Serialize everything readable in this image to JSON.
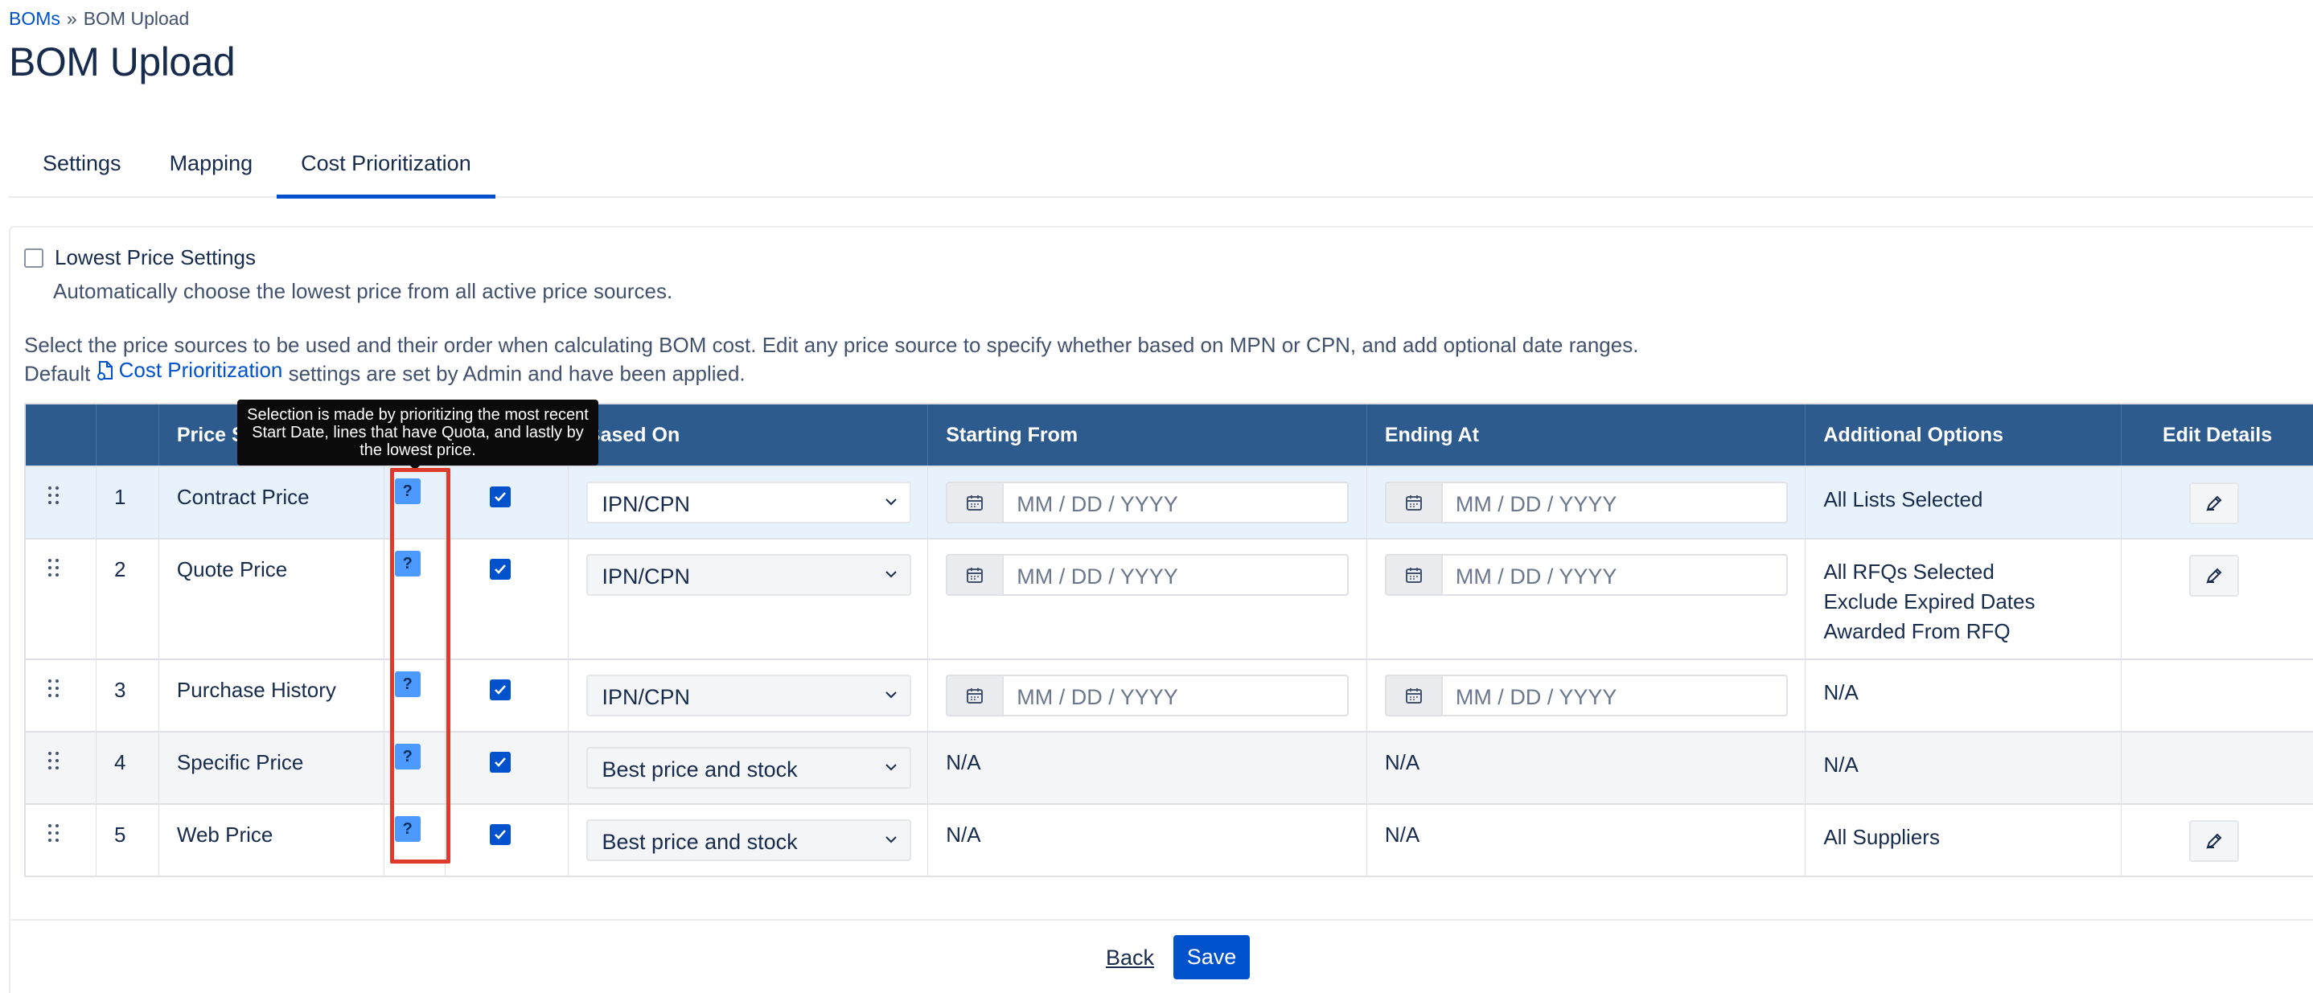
{
  "breadcrumb": {
    "parent": "BOMs",
    "separator": "»",
    "current": "BOM Upload"
  },
  "page_title": "BOM Upload",
  "tabs": [
    {
      "label": "Settings",
      "active": false
    },
    {
      "label": "Mapping",
      "active": false
    },
    {
      "label": "Cost Prioritization",
      "active": true
    }
  ],
  "lowest_price": {
    "label": "Lowest Price Settings",
    "checked": false,
    "description": "Automatically choose the lowest price from all active price sources."
  },
  "instructions": {
    "line1": "Select the price sources to be used and their order when calculating BOM cost. Edit any price source to specify whether based on MPN or CPN, and add optional date ranges.",
    "prefix": "Default",
    "link": "Cost Prioritization",
    "suffix": "settings are set by Admin and have been applied."
  },
  "table": {
    "headers": {
      "price_source": "Price S",
      "based_on": "Based On",
      "starting_from": "Starting From",
      "ending_at": "Ending At",
      "additional_options": "Additional Options",
      "edit_details": "Edit Details"
    },
    "rows": [
      {
        "num": "1",
        "name": "Contract Price",
        "help": "?",
        "based_on": "IPN/CPN",
        "start": "MM / DD / YYYY",
        "end": "MM / DD / YYYY",
        "options": [
          "All Lists Selected"
        ]
      },
      {
        "num": "2",
        "name": "Quote Price",
        "help": "?",
        "based_on": "IPN/CPN",
        "start": "MM / DD / YYYY",
        "end": "MM / DD / YYYY",
        "options": [
          "All RFQs Selected",
          "Exclude Expired Dates",
          "Awarded From RFQ"
        ]
      },
      {
        "num": "3",
        "name": "Purchase History",
        "help": "?",
        "based_on": "IPN/CPN",
        "start": "MM / DD / YYYY",
        "end": "MM / DD / YYYY",
        "options": [
          "N/A"
        ]
      },
      {
        "num": "4",
        "name": "Specific Price",
        "help": "?",
        "based_on": "Best price and stock",
        "start": "N/A",
        "end": "N/A",
        "options": [
          "N/A"
        ]
      },
      {
        "num": "5",
        "name": "Web Price",
        "help": "?",
        "based_on": "Best price and stock",
        "start": "N/A",
        "end": "N/A",
        "options": [
          "All Suppliers"
        ]
      }
    ]
  },
  "tooltip": "Selection is made by prioritizing the most recent Start Date, lines that have Quota, and lastly by the lowest price.",
  "footer": {
    "back": "Back",
    "save": "Save"
  },
  "colors": {
    "accent": "#0052cc",
    "header_bg": "#2e5b8e",
    "highlight": "#e03a2a",
    "help_icon": "#4c9aff"
  }
}
